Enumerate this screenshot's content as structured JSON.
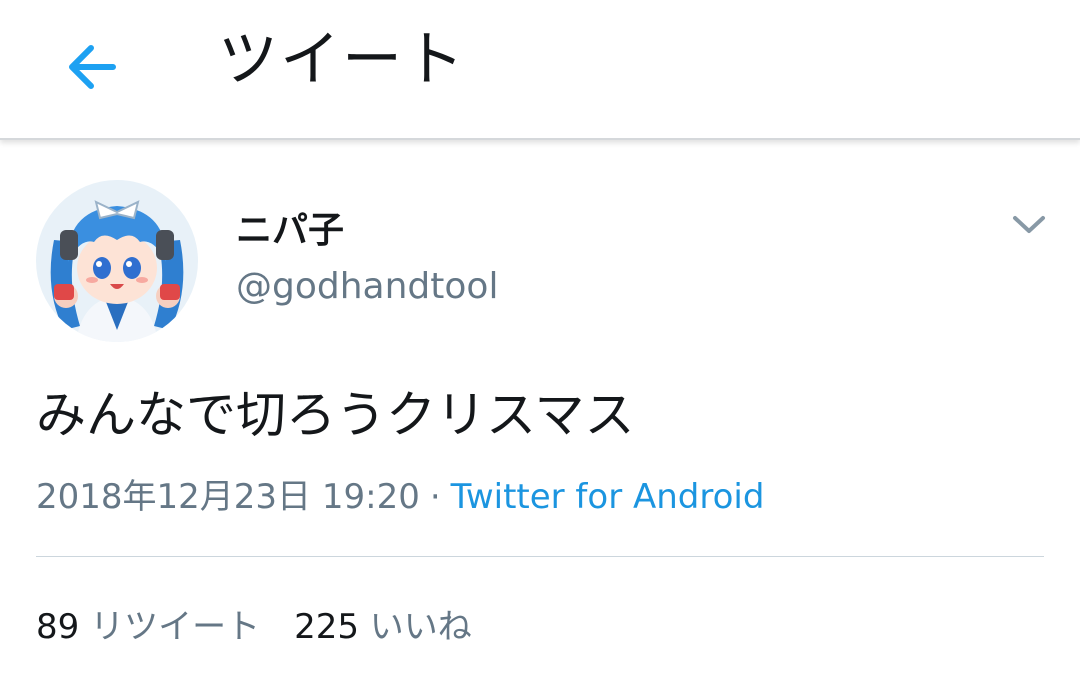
{
  "header": {
    "back_icon": "arrow-left-icon",
    "title": "ツイート",
    "accent_color": "#1da1f2"
  },
  "tweet": {
    "author": {
      "display_name": "ニパ子",
      "handle": "@godhandtool",
      "avatar": "avatar-image"
    },
    "more_icon": "chevron-down-icon",
    "text": "みんなで切ろうクリスマス",
    "timestamp": "2018年12月23日 19:20",
    "separator": "·",
    "source": "Twitter for Android",
    "source_color": "#1b95e0"
  },
  "stats": {
    "retweets": {
      "count": "89",
      "label": "リツイート"
    },
    "likes": {
      "count": "225",
      "label": "いいね"
    }
  }
}
